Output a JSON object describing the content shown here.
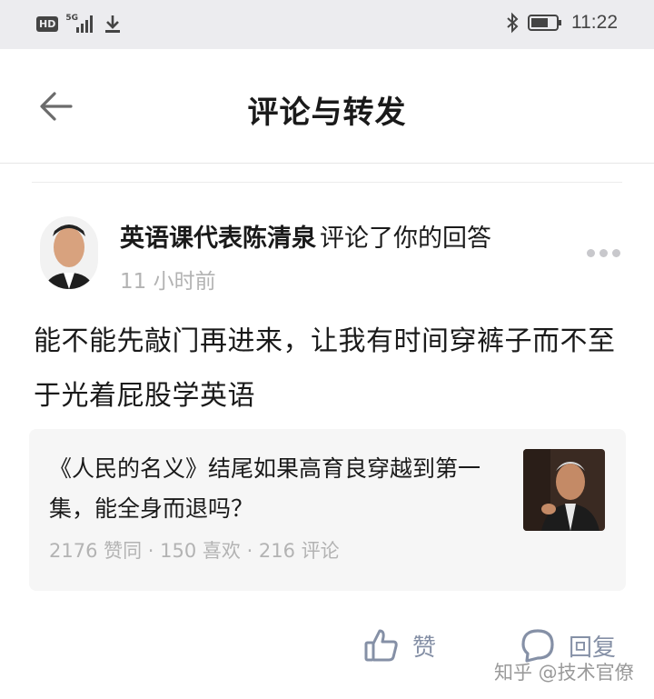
{
  "status_bar": {
    "left_badge": "HD",
    "network": "5G",
    "time": "11:22",
    "icons": [
      "hd-icon",
      "signal-icon",
      "download-icon",
      "bluetooth-icon",
      "battery-icon"
    ]
  },
  "header": {
    "title": "评论与转发",
    "back_icon": "arrow-left-icon"
  },
  "notification": {
    "author_name": "英语课代表陈清泉",
    "action_text": "评论了你的回答",
    "time_ago": "11 小时前",
    "comment": "能不能先敲门再进来，让我有时间穿裤子而不至于光着屁股学英语",
    "more_icon": "more-horizontal-icon"
  },
  "answer_card": {
    "title": "《人民的名义》结尾如果高育良穿越到第一集，能全身而退吗？",
    "stats": "2176 赞同 · 150 喜欢 · 216 评论"
  },
  "actions": {
    "like_label": "赞",
    "reply_label": "回复",
    "like_icon": "thumbs-up-icon",
    "reply_icon": "comment-bubble-icon"
  },
  "watermark": "知乎 @技术官僚",
  "colors": {
    "status_bar_bg": "#ececef",
    "muted_text": "#b3b3b3",
    "action_gray": "#8590a6",
    "card_bg": "#f6f6f6"
  }
}
